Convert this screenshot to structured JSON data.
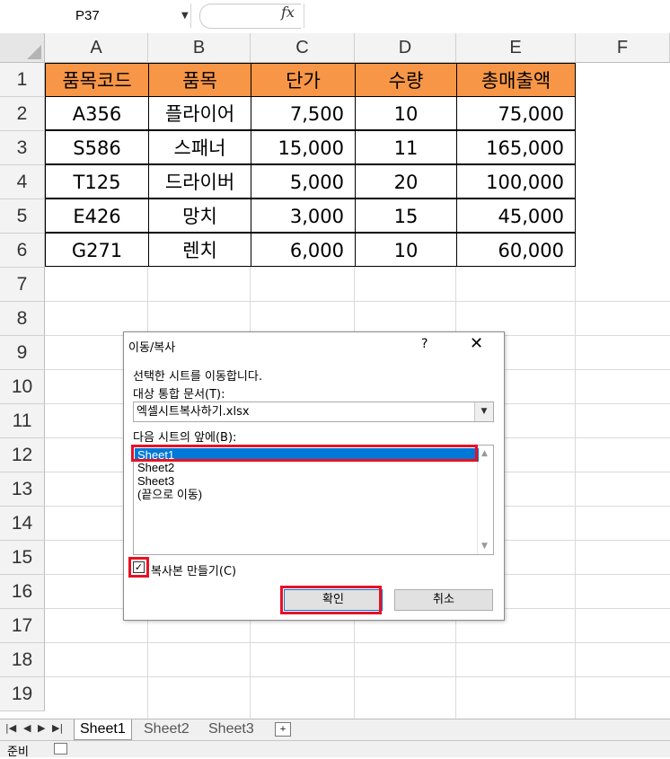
{
  "formula_bar": {
    "name_box": "P37",
    "fx": "fx",
    "formula": ""
  },
  "columns": [
    "A",
    "B",
    "C",
    "D",
    "E",
    "F"
  ],
  "rows": [
    "1",
    "2",
    "3",
    "4",
    "5",
    "6",
    "7",
    "8",
    "9",
    "10",
    "11",
    "12",
    "13",
    "14",
    "15",
    "16",
    "17",
    "18",
    "19"
  ],
  "table": {
    "headers": [
      "품목코드",
      "품목",
      "단가",
      "수량",
      "총매출액"
    ],
    "rows": [
      [
        "A356",
        "플라이어",
        "7,500",
        "10",
        "75,000"
      ],
      [
        "S586",
        "스패너",
        "15,000",
        "11",
        "165,000"
      ],
      [
        "T125",
        "드라이버",
        "5,000",
        "20",
        "100,000"
      ],
      [
        "E426",
        "망치",
        "3,000",
        "15",
        "45,000"
      ],
      [
        "G271",
        "렌치",
        "6,000",
        "10",
        "60,000"
      ]
    ],
    "header_color": "#f79646"
  },
  "sheet_tabs": [
    "Sheet1",
    "Sheet2",
    "Sheet3"
  ],
  "status": {
    "text": "준비"
  },
  "dialog": {
    "title": "이동/복사",
    "help": "?",
    "close": "✕",
    "description": "선택한 시트를 이동합니다.",
    "target_book_label": "대상 통합 문서(T):",
    "target_book_value": "엑셀시트복사하기.xlsx",
    "before_sheet_label": "다음 시트의 앞에(B):",
    "sheet_list": [
      "Sheet1",
      "Sheet2",
      "Sheet3",
      "(끝으로 이동)"
    ],
    "selected_index": 0,
    "copy_checkbox_label": "복사본 만들기(C)",
    "copy_checked": true,
    "ok_label": "확인",
    "cancel_label": "취소",
    "highlight_color": "#e81123"
  }
}
